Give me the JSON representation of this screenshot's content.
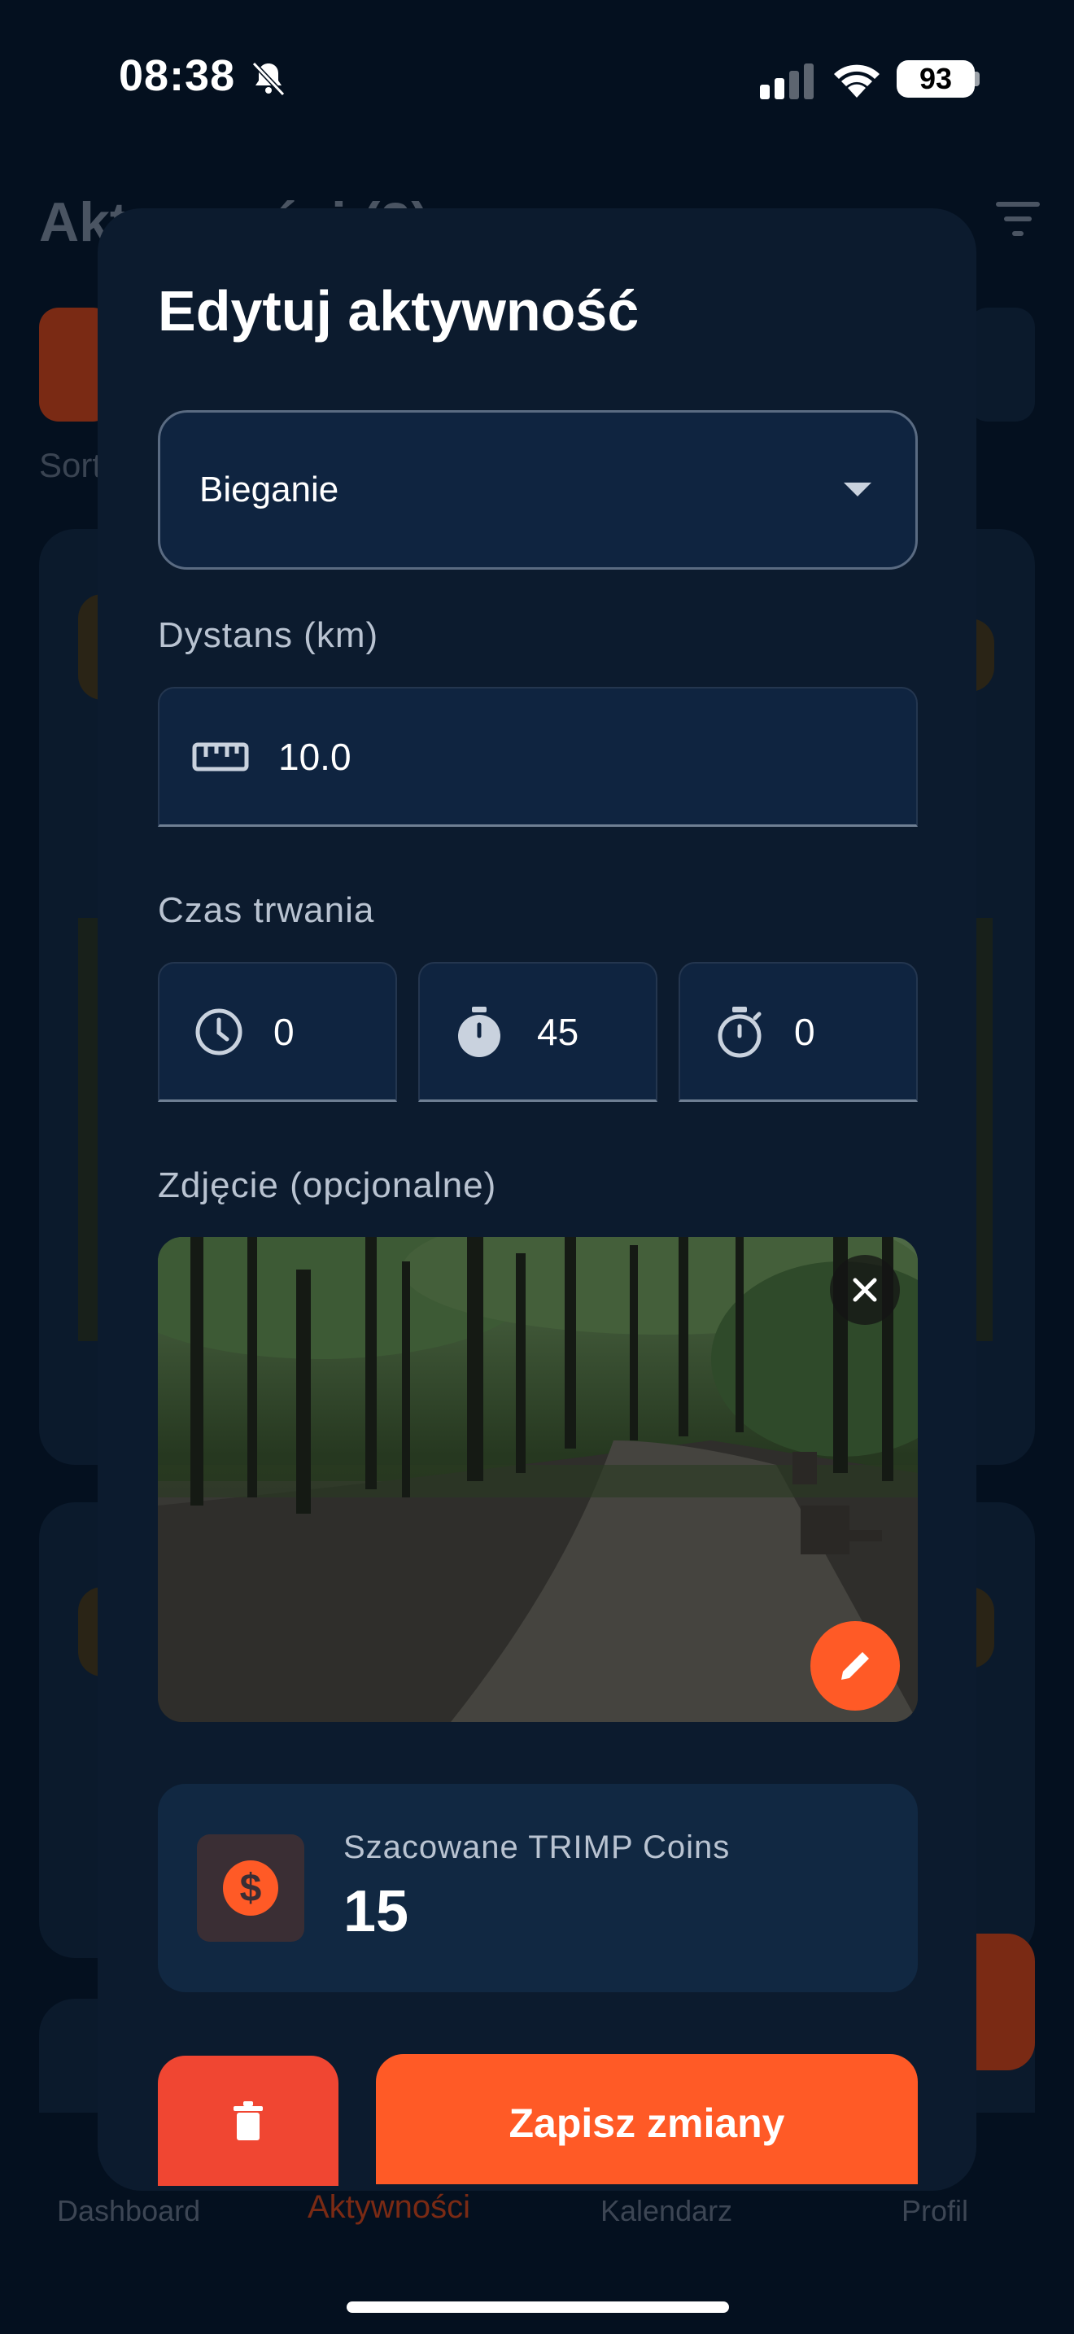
{
  "status_bar": {
    "time": "08:38",
    "battery": "93"
  },
  "background": {
    "title": "Aktywności (3)",
    "sort_label": "Sortuj"
  },
  "bottom_nav": {
    "items": [
      {
        "label": "Dashboard",
        "active": false
      },
      {
        "label": "Aktywności",
        "active": true
      },
      {
        "label": "Kalendarz",
        "active": false
      },
      {
        "label": "Profil",
        "active": false
      }
    ]
  },
  "modal": {
    "title": "Edytuj aktywność",
    "activity_type": {
      "selected": "Bieganie"
    },
    "distance": {
      "label": "Dystans (km)",
      "value": "10.0",
      "icon": "ruler-icon"
    },
    "duration": {
      "label": "Czas trwania",
      "hours": {
        "value": "0",
        "icon": "clock-icon"
      },
      "minutes": {
        "value": "45",
        "icon": "stopwatch-filled-icon"
      },
      "seconds": {
        "value": "0",
        "icon": "stopwatch-outline-icon"
      }
    },
    "photo": {
      "label": "Zdjęcie (opcjonalne)"
    },
    "coins": {
      "label": "Szacowane TRIMP Coins",
      "value": "15",
      "icon": "dollar-coin-icon"
    },
    "save_label": "Zapisz zmiany"
  },
  "colors": {
    "accent": "#ff5a26",
    "danger": "#f04632",
    "modal_bg": "#0c1b2e",
    "field_bg": "#0f2440"
  }
}
